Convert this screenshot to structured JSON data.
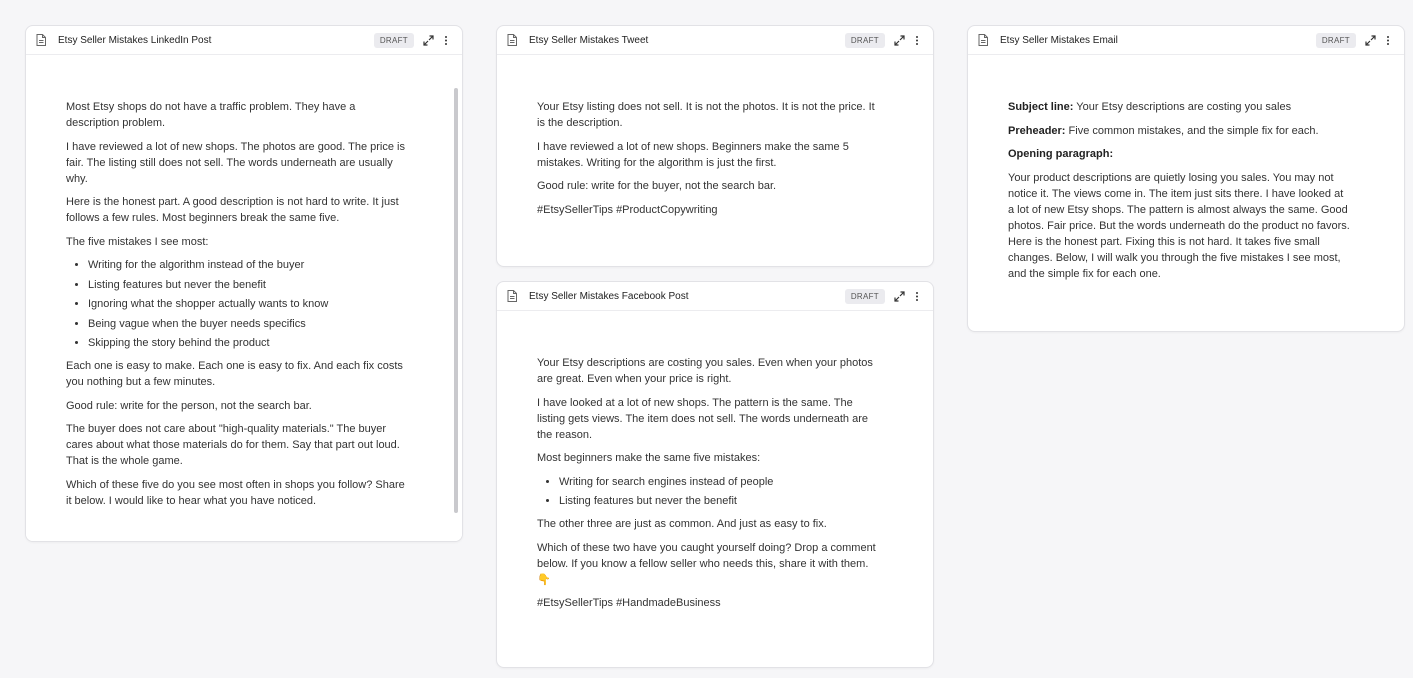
{
  "linkedin": {
    "title": "Etsy Seller Mistakes LinkedIn Post",
    "badge": "DRAFT",
    "p1": "Most Etsy shops do not have a traffic problem. They have a description problem.",
    "p2": "I have reviewed a lot of new shops. The photos are good. The price is fair. The listing still does not sell. The words underneath are usually why.",
    "p3": "Here is the honest part. A good description is not hard to write. It just follows a few rules. Most beginners break the same five.",
    "p4": "The five mistakes I see most:",
    "list": [
      "Writing for the algorithm instead of the buyer",
      "Listing features but never the benefit",
      "Ignoring what the shopper actually wants to know",
      "Being vague when the buyer needs specifics",
      "Skipping the story behind the product"
    ],
    "p5": "Each one is easy to make. Each one is easy to fix. And each fix costs you nothing but a few minutes.",
    "p6": "Good rule: write for the person, not the search bar.",
    "p7": "The buyer does not care about \"high-quality materials.\" The buyer cares about what those materials do for them. Say that part out loud. That is the whole game.",
    "p8": "Which of these five do you see most often in shops you follow? Share it below. I would like to hear what you have noticed."
  },
  "tweet": {
    "title": "Etsy Seller Mistakes Tweet",
    "badge": "DRAFT",
    "p1": "Your Etsy listing does not sell. It is not the photos. It is not the price. It is the description.",
    "p2": "I have reviewed a lot of new shops. Beginners make the same 5 mistakes. Writing for the algorithm is just the first.",
    "p3": "Good rule: write for the buyer, not the search bar.",
    "p4": "#EtsySellerTips #ProductCopywriting"
  },
  "facebook": {
    "title": "Etsy Seller Mistakes Facebook Post",
    "badge": "DRAFT",
    "p1": "Your Etsy descriptions are costing you sales. Even when your photos are great. Even when your price is right.",
    "p2": "I have looked at a lot of new shops. The pattern is the same. The listing gets views. The item does not sell. The words underneath are the reason.",
    "p3": "Most beginners make the same five mistakes:",
    "list": [
      "Writing for search engines instead of people",
      "Listing features but never the benefit"
    ],
    "p4": "The other three are just as common. And just as easy to fix.",
    "p5": "Which of these two have you caught yourself doing? Drop a comment below. If you know a fellow seller who needs this, share it with them. 👇",
    "p6": "#EtsySellerTips #HandmadeBusiness"
  },
  "email": {
    "title": "Etsy Seller Mistakes Email",
    "badge": "DRAFT",
    "subject_label": "Subject line:",
    "subject_value": " Your Etsy descriptions are costing you sales",
    "preheader_label": "Preheader:",
    "preheader_value": " Five common mistakes, and the simple fix for each.",
    "opening_label": "Opening paragraph:",
    "opening_text": "Your product descriptions are quietly losing you sales. You may not notice it. The views come in. The item just sits there. I have looked at a lot of new Etsy shops. The pattern is almost always the same. Good photos. Fair price. But the words underneath do the product no favors. Here is the honest part. Fixing this is not hard. It takes five small changes. Below, I will walk you through the five mistakes I see most, and the simple fix for each one."
  }
}
